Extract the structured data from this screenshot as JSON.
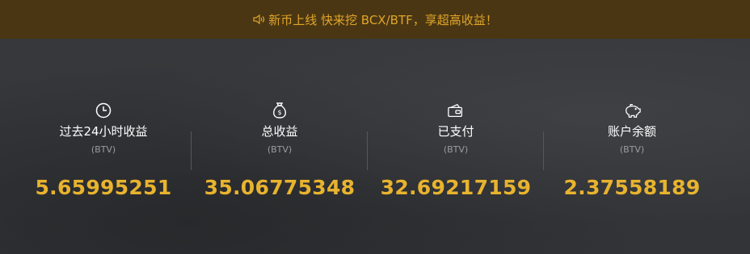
{
  "banner": {
    "icon": "speaker-icon",
    "text": "新币上线 快来挖 BCX/BTF，享超高收益！",
    "color": "#e0a52a"
  },
  "stats": [
    {
      "icon": "clock-icon",
      "title": "过去24小时收益",
      "unit": "(BTV)",
      "value": "5.65995251"
    },
    {
      "icon": "money-bag-icon",
      "title": "总收益",
      "unit": "(BTV)",
      "value": "35.06775348"
    },
    {
      "icon": "wallet-cards-icon",
      "title": "已支付",
      "unit": "(BTV)",
      "value": "32.69217159"
    },
    {
      "icon": "piggy-bank-icon",
      "title": "账户余额",
      "unit": "(BTV)",
      "value": "2.37558189"
    }
  ],
  "colors": {
    "accent": "#e8b32e",
    "banner_bg": "#4a3612",
    "background": "#35373a"
  }
}
